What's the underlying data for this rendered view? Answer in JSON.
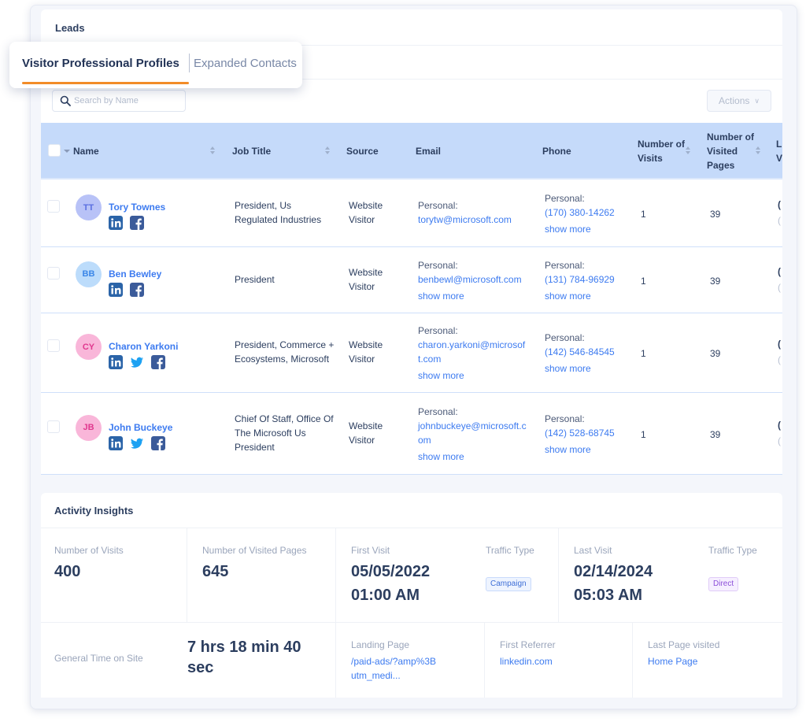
{
  "page": {
    "title": "Leads"
  },
  "tabs": [
    {
      "label": "Visitor Professional Profiles",
      "active": true
    },
    {
      "label": "Expanded Contacts",
      "active": false
    }
  ],
  "colors": {
    "accent_tab": "#f28c28",
    "link": "#3d7bf0",
    "header_bg": "#c5dafa"
  },
  "toolbar": {
    "search_placeholder": "Search by Name",
    "search_value": "",
    "actions_label": "Actions"
  },
  "table": {
    "columns": [
      {
        "label": "Name",
        "sortable": true
      },
      {
        "label": "Job Title",
        "sortable": true
      },
      {
        "label": "Source",
        "sortable": false
      },
      {
        "label": "Email",
        "sortable": false
      },
      {
        "label": "Phone",
        "sortable": false
      },
      {
        "label": "Number of Visits",
        "sortable": true
      },
      {
        "label": "Number of Visited Pages",
        "sortable": true
      },
      {
        "label": "L V",
        "sortable": false
      }
    ],
    "rows": [
      {
        "initials": "TT",
        "name": "Tory Townes",
        "socials": [
          "linkedin",
          "facebook"
        ],
        "job_title": "President, Us Regulated Industries",
        "source": "Website Visitor",
        "email_label": "Personal:",
        "email": "torytw@microsoft.com",
        "email_show_more": "",
        "phone_label": "Personal:",
        "phone": "(170) 380-14262",
        "phone_show_more": "show more",
        "visits": "1",
        "pages": "39"
      },
      {
        "initials": "BB",
        "name": "Ben Bewley",
        "socials": [
          "linkedin",
          "facebook"
        ],
        "job_title": "President",
        "source": "Website Visitor",
        "email_label": "Personal:",
        "email": "benbewl@microsoft.com",
        "email_show_more": "show more",
        "phone_label": "Personal:",
        "phone": "(131) 784-96929",
        "phone_show_more": "show more",
        "visits": "1",
        "pages": "39"
      },
      {
        "initials": "CY",
        "name": "Charon Yarkoni",
        "socials": [
          "linkedin",
          "twitter",
          "facebook"
        ],
        "job_title": "President, Commerce + Ecosystems, Microsoft",
        "source": "Website Visitor",
        "email_label": "Personal:",
        "email": "charon.yarkoni@microsoft.com",
        "email_show_more": "show more",
        "phone_label": "Personal:",
        "phone": "(142) 546-84545",
        "phone_show_more": "show more",
        "visits": "1",
        "pages": "39"
      },
      {
        "initials": "JB",
        "name": "John Buckeye",
        "socials": [
          "linkedin",
          "twitter",
          "facebook"
        ],
        "job_title": "Chief Of Staff, Office Of The Microsoft Us President",
        "source": "Website Visitor",
        "email_label": "Personal:",
        "email": "johnbuckeye@microsoft.com",
        "email_show_more": "show more",
        "phone_label": "Personal:",
        "phone": "(142) 528-68745",
        "phone_show_more": "show more",
        "visits": "1",
        "pages": "39"
      }
    ]
  },
  "insights": {
    "title": "Activity Insights",
    "visits_label": "Number of Visits",
    "visits_value": "400",
    "pages_label": "Number of Visited Pages",
    "pages_value": "645",
    "first_visit_label": "First Visit",
    "first_visit_date": "05/05/2022",
    "first_visit_time": "01:00 AM",
    "first_traffic_label": "Traffic Type",
    "first_traffic_value": "Campaign",
    "last_visit_label": "Last Visit",
    "last_visit_date": "02/14/2024",
    "last_visit_time": "05:03 AM",
    "last_traffic_label": "Traffic Type",
    "last_traffic_value": "Direct",
    "time_label": "General Time on Site",
    "time_value": "7 hrs 18 min 40 sec",
    "landing_label": "Landing Page",
    "landing_value": "/paid-ads/?amp%3Butm_medi...",
    "referrer_label": "First Referrer",
    "referrer_value": "linkedin.com",
    "last_page_label": "Last Page visited",
    "last_page_value": "Home Page"
  }
}
